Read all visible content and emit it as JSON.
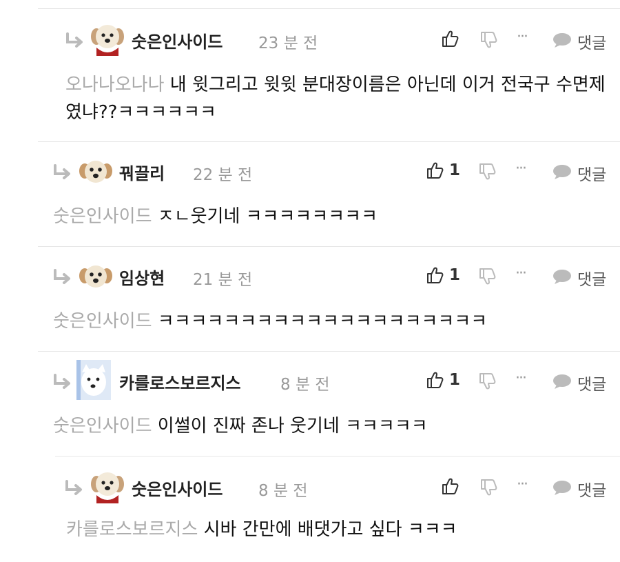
{
  "colors": {
    "name": "#222222",
    "time": "#999999",
    "mention": "#aaaaaa",
    "icon": "#bbbbbb",
    "divider": "#e6e6e6"
  },
  "icons": {
    "reply_arrow": "reply-arrow-icon",
    "like": "thumbs-up-icon",
    "dislike": "thumbs-down-icon",
    "more": "ellipsis-icon",
    "reply": "speech-bubble-icon"
  },
  "comments": [
    {
      "name": "숫은인사이드",
      "time": "23 분 전",
      "like_count": "",
      "reply_label": "댓글",
      "more": "···",
      "mention": "오나나오나나",
      "text": "내 윗그리고 윗윗 분대장이름은 아닌데 이거 전국구 수면제였냐??ㅋㅋㅋㅋㅋㅋ"
    },
    {
      "name": "꿔끌리",
      "time": "22 분 전",
      "like_count": "1",
      "reply_label": "댓글",
      "more": "···",
      "mention": "숫은인사이드",
      "text": "ㅈㄴ웃기네 ㅋㅋㅋㅋㅋㅋㅋㅋ"
    },
    {
      "name": "임상현",
      "time": "21 분 전",
      "like_count": "1",
      "reply_label": "댓글",
      "more": "···",
      "mention": "숫은인사이드",
      "text": "ㅋㅋㅋㅋㅋㅋㅋㅋㅋㅋㅋㅋㅋㅋㅋㅋㅋㅋㅋㅋ"
    },
    {
      "name": "카를로스보르지스",
      "time": "8 분 전",
      "like_count": "1",
      "reply_label": "댓글",
      "more": "···",
      "mention": "숫은인사이드",
      "text": "이썰이 진짜 존나 웃기네 ㅋㅋㅋㅋㅋ"
    },
    {
      "name": "숫은인사이드",
      "time": "8 분 전",
      "like_count": "",
      "reply_label": "댓글",
      "more": "···",
      "mention": "카를로스보르지스",
      "text": "시바 간만에 배댓가고 싶다 ㅋㅋㅋ"
    }
  ]
}
